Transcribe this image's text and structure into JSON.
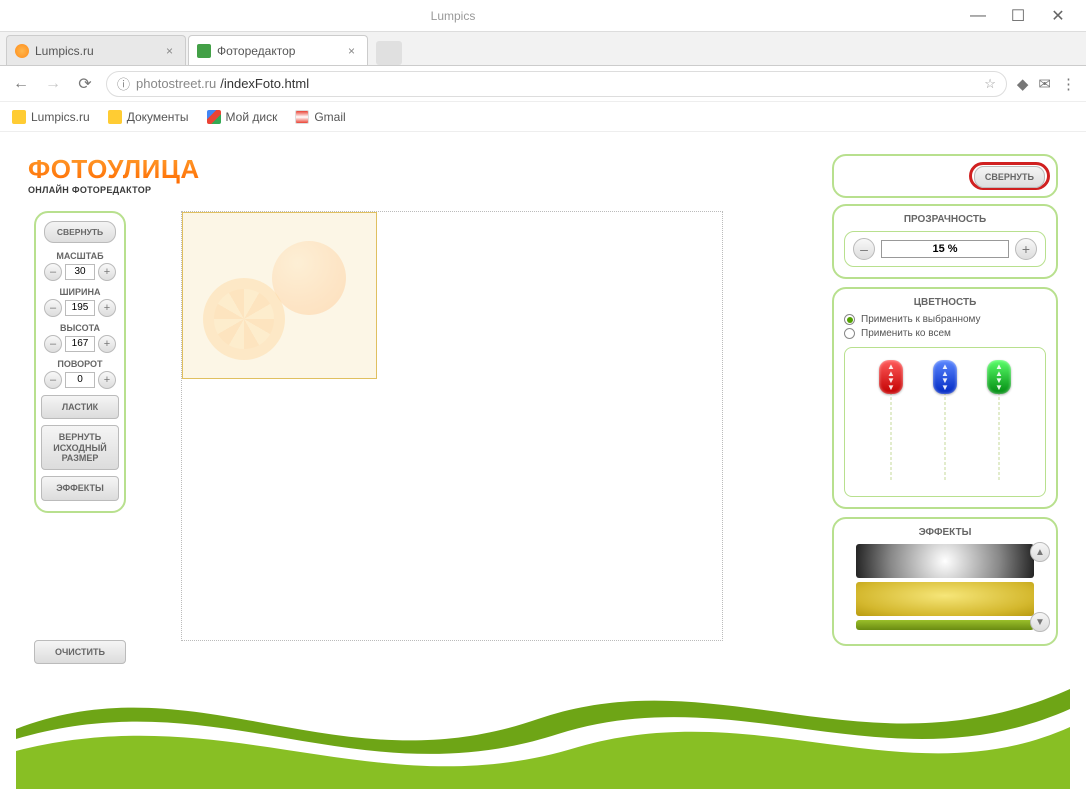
{
  "window": {
    "title": "Lumpics"
  },
  "browser": {
    "tabs": [
      {
        "label": "Lumpics.ru"
      },
      {
        "label": "Фоторедактор"
      }
    ],
    "url_host": "photostreet.ru",
    "url_path": "/indexFoto.html",
    "bookmarks": {
      "lumpics": "Lumpics.ru",
      "docs": "Документы",
      "drive": "Мой диск",
      "gmail": "Gmail"
    }
  },
  "app": {
    "logo": {
      "main": "ФОТОУЛИЦА",
      "sub": "ОНЛАЙН ФОТОРЕДАКТОР"
    },
    "left": {
      "collapse": "СВЕРНУТЬ",
      "scale": {
        "label": "МАСШТАБ",
        "value": "30"
      },
      "width": {
        "label": "ШИРИНА",
        "value": "195"
      },
      "height": {
        "label": "ВЫСОТА",
        "value": "167"
      },
      "rotation": {
        "label": "ПОВОРОТ",
        "value": "0"
      },
      "eraser": "ЛАСТИК",
      "restore": "ВЕРНУТЬ ИСХОДНЫЙ РАЗМЕР",
      "effects": "ЭФФЕКТЫ",
      "clear": "ОЧИСТИТЬ"
    },
    "right": {
      "collapse": "СВЕРНУТЬ",
      "transparency": {
        "title": "ПРОЗРАЧНОСТЬ",
        "value": "15 %"
      },
      "color": {
        "title": "ЦВЕТНОСТЬ",
        "apply_selected": "Применить к выбранному",
        "apply_all": "Применить ко всем"
      },
      "effects": {
        "title": "ЭФФЕКТЫ"
      }
    }
  }
}
